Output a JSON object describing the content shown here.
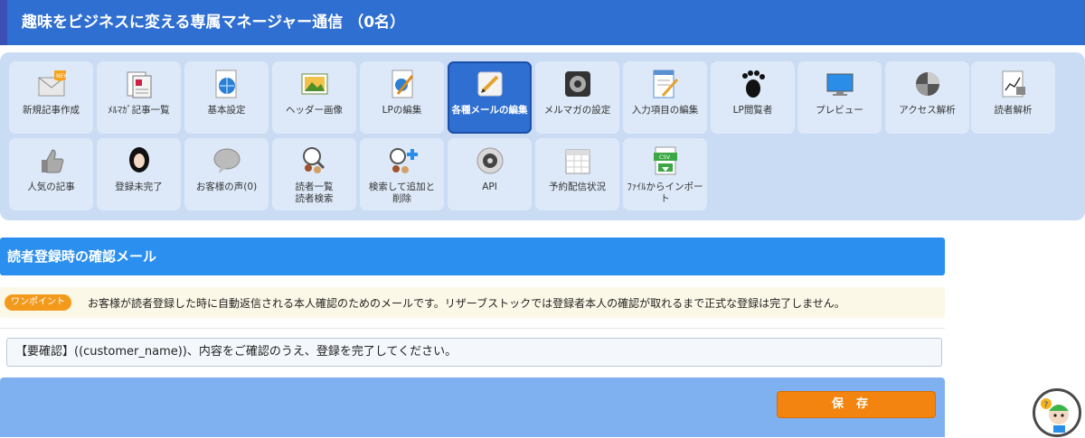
{
  "header": {
    "title": "趣味をビジネスに変える専属マネージャー通信 （0名）"
  },
  "toolbar": {
    "row1": [
      {
        "label": "新規記事作成",
        "icon": "mail-new-icon"
      },
      {
        "label": "ﾒﾙﾏｶﾞ記事一覧",
        "icon": "articles-list-icon"
      },
      {
        "label": "基本設定",
        "icon": "globe-document-icon"
      },
      {
        "label": "ヘッダー画像",
        "icon": "image-icon"
      },
      {
        "label": "LPの編集",
        "icon": "lp-edit-icon"
      },
      {
        "label": "各種メールの編集",
        "icon": "pencil-edit-icon"
      },
      {
        "label": "メルマガの設定",
        "icon": "settings-icon"
      },
      {
        "label": "入力項目の編集",
        "icon": "form-edit-icon"
      },
      {
        "label": "LP閲覧者",
        "icon": "footprint-icon"
      },
      {
        "label": "プレビュー",
        "icon": "monitor-icon"
      },
      {
        "label": "アクセス解析",
        "icon": "pie-chart-icon"
      },
      {
        "label": "読者解析",
        "icon": "reader-analysis-icon"
      }
    ],
    "row2": [
      {
        "label": "人気の記事",
        "icon": "thumbs-up-icon"
      },
      {
        "label": "登録未完了",
        "icon": "user-silhouette-icon"
      },
      {
        "label": "お客様の声(0)",
        "icon": "speech-bubble-icon"
      },
      {
        "label": "読者一覧\n読者検索",
        "icon": "reader-search-icon"
      },
      {
        "label": "検索して追加と\n削除",
        "icon": "add-reader-icon"
      },
      {
        "label": "API",
        "icon": "api-gear-icon"
      },
      {
        "label": "予約配信状況",
        "icon": "calendar-icon"
      },
      {
        "label": "ﾌｧｲﾙからインポート",
        "icon": "csv-import-icon"
      }
    ]
  },
  "section": {
    "title": "読者登録時の確認メール",
    "tip_badge": "ワンポイント",
    "tip_text": "お客様が読者登録した時に自動返信される本人確認のためのメールです。リザーブストックでは登録者本人の確認が取れるまで正式な登録は完了しません。",
    "subject_value": "【要確認】((customer_name))、内容をご確認のうえ、登録を完了してください。"
  },
  "actions": {
    "save_label": "保存"
  },
  "colors": {
    "header": "#2f6fd1",
    "accent": "#2b8ff0",
    "save": "#f3840f"
  }
}
